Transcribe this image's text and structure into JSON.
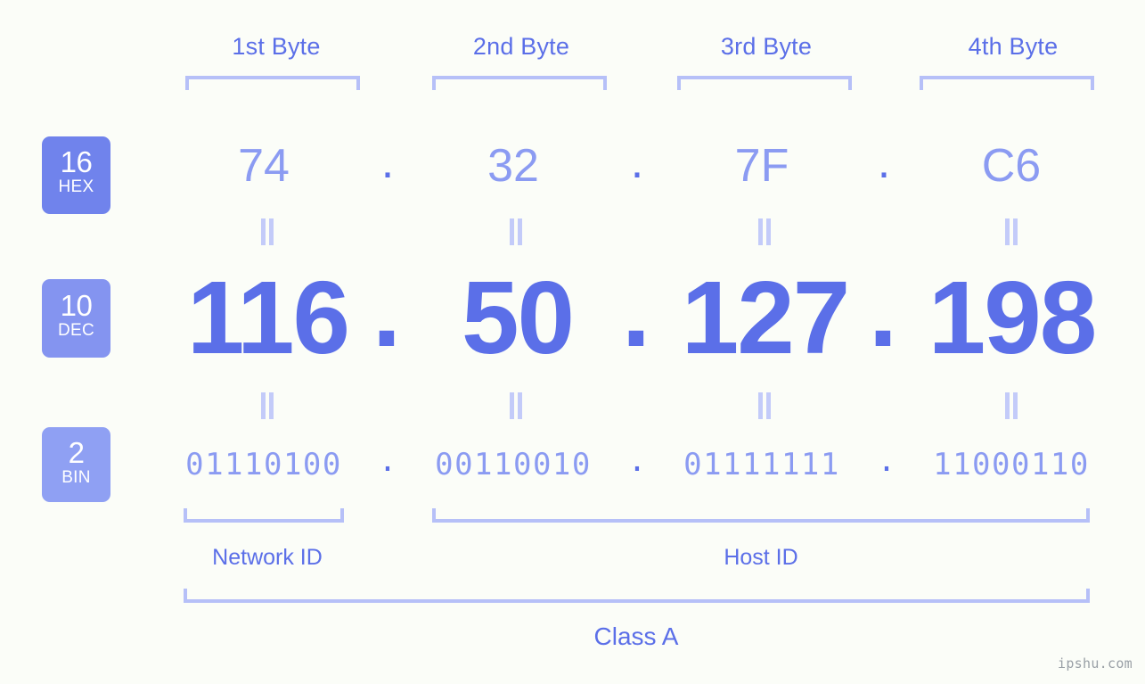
{
  "meta": {
    "watermark": "ipshu.com"
  },
  "byte_headers": [
    {
      "label": "1st Byte"
    },
    {
      "label": "2nd Byte"
    },
    {
      "label": "3rd Byte"
    },
    {
      "label": "4th Byte"
    }
  ],
  "rows": {
    "hex": {
      "badge_number": "16",
      "badge_name": "HEX",
      "badge_color": "#7083ec",
      "values": [
        "74",
        "32",
        "7F",
        "C6"
      ],
      "separator": "."
    },
    "dec": {
      "badge_number": "10",
      "badge_name": "DEC",
      "badge_color": "#8494f0",
      "values": [
        "116",
        "50",
        "127",
        "198"
      ],
      "separator": "."
    },
    "bin": {
      "badge_number": "2",
      "badge_name": "BIN",
      "badge_color": "#8fa0f3",
      "values": [
        "01110100",
        "00110010",
        "01111111",
        "11000110"
      ],
      "separator": "."
    }
  },
  "equivalence_marks": {
    "hex_to_dec": [
      "=",
      "=",
      "=",
      "="
    ],
    "dec_to_bin": [
      "=",
      "=",
      "=",
      "="
    ]
  },
  "partitions": {
    "network_id": "Network ID",
    "host_id": "Host ID",
    "class": "Class A"
  },
  "colors": {
    "background": "#fbfdf8",
    "accent": "#5b6fe8",
    "accent_light": "#8b9bf2",
    "bracket": "#b6c0f8",
    "equals": "#c3cbf9",
    "watermark": "#9aa0a6"
  }
}
